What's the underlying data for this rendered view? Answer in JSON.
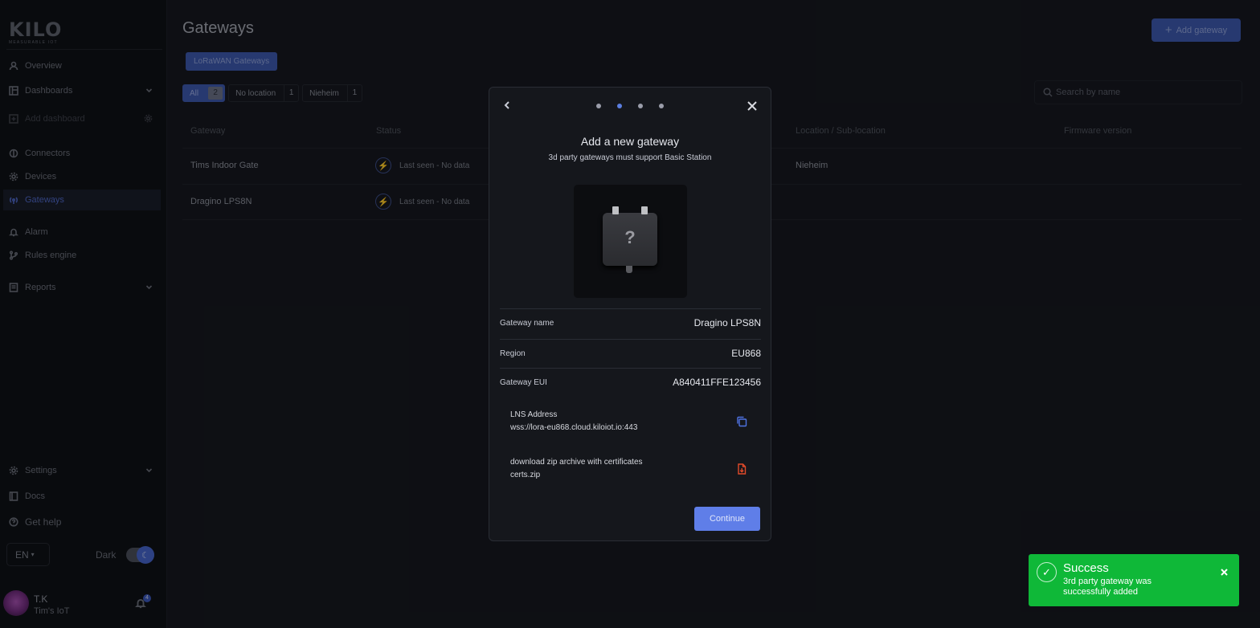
{
  "sidebar": {
    "logo": "KILO",
    "logo_sub": "MEASURABLE IOT",
    "items": [
      {
        "label": "Overview",
        "icon": "user-icon"
      },
      {
        "label": "Dashboards",
        "icon": "dashboard-icon"
      },
      {
        "label": "Add dashboard",
        "icon": "plus-icon"
      },
      {
        "label": "Connectors",
        "icon": "connector-icon"
      },
      {
        "label": "Devices",
        "icon": "gear-icon"
      },
      {
        "label": "Gateways",
        "icon": "antenna-icon"
      },
      {
        "label": "Alarm",
        "icon": "bell-icon"
      },
      {
        "label": "Rules engine",
        "icon": "branch-icon"
      },
      {
        "label": "Reports",
        "icon": "report-icon"
      },
      {
        "label": "Settings",
        "icon": "gear-icon"
      },
      {
        "label": "Docs",
        "icon": "book-icon"
      },
      {
        "label": "Get help",
        "icon": "help-icon"
      }
    ],
    "language": "EN",
    "dark_label": "Dark",
    "user": {
      "initials": "T.K",
      "org": "Tim's IoT"
    },
    "notifications": "4"
  },
  "main": {
    "title": "Gateways",
    "add_button": "Add gateway",
    "type_tab": "LoRaWAN Gateways",
    "filters": [
      {
        "label": "All",
        "count": "2"
      },
      {
        "label": "No location",
        "count": "1"
      },
      {
        "label": "Nieheim",
        "count": "1"
      }
    ],
    "search_placeholder": "Search by name",
    "columns": [
      "Gateway",
      "Status",
      "Location / Sub-location",
      "Firmware version"
    ],
    "rows": [
      {
        "gateway": "Tims Indoor Gate",
        "status": "Last seen - No data",
        "location": "Nieheim",
        "firmware": ""
      },
      {
        "gateway": "Dragino LPS8N",
        "status": "Last seen - No data",
        "location": "",
        "firmware": ""
      }
    ]
  },
  "modal": {
    "title": "Add a new gateway",
    "subtitle": "3d party gateways must support Basic Station",
    "step_total": 4,
    "step_current": 2,
    "fields": [
      {
        "label": "Gateway name",
        "value": "Dragino LPS8N"
      },
      {
        "label": "Region",
        "value": "EU868"
      },
      {
        "label": "Gateway EUI",
        "value": "A840411FFE123456"
      }
    ],
    "lns": {
      "label": "LNS Address",
      "value": "wss://lora-eu868.cloud.kiloiot.io:443"
    },
    "certs": {
      "label": "download zip archive with certificates",
      "value": "certs.zip"
    },
    "continue": "Continue",
    "image_glyph": "?"
  },
  "toast": {
    "title": "Success",
    "message": "3rd party gateway was successfully added",
    "color": "#0fb838"
  }
}
